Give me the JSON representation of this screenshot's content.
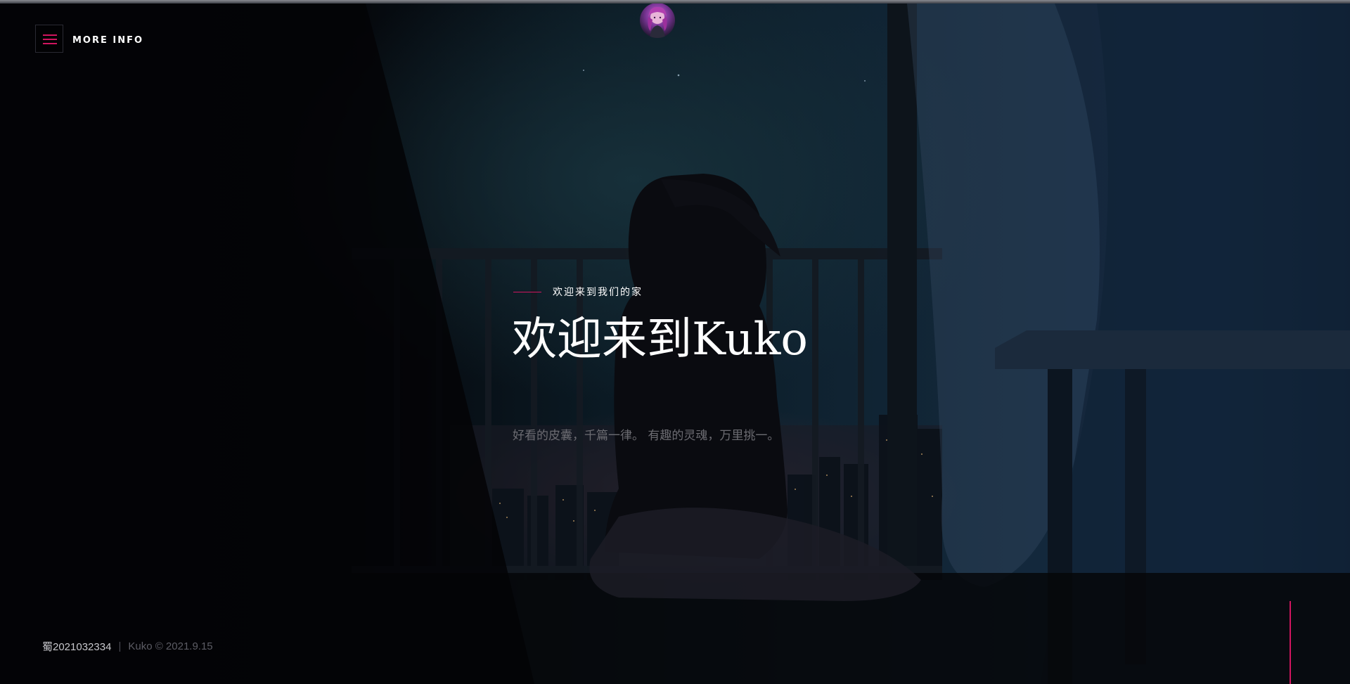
{
  "header": {
    "menu_label": "MORE INFO",
    "menu_icon": "hamburger-icon",
    "avatar_icon": "avatar-anime-girl"
  },
  "hero": {
    "eyebrow": "欢迎来到我们的家",
    "headline": "欢迎来到Kuko",
    "tagline": "好看的皮囊，千篇一律。 有趣的灵魂，万里挑一。"
  },
  "footer": {
    "icp": "蜀2021032334",
    "separator": "|",
    "copyright": "Kuko © 2021.9.15"
  },
  "colors": {
    "accent": "#d0155f",
    "background": "#05070c",
    "text_primary": "#ffffff",
    "text_muted": "#6c6c72"
  }
}
